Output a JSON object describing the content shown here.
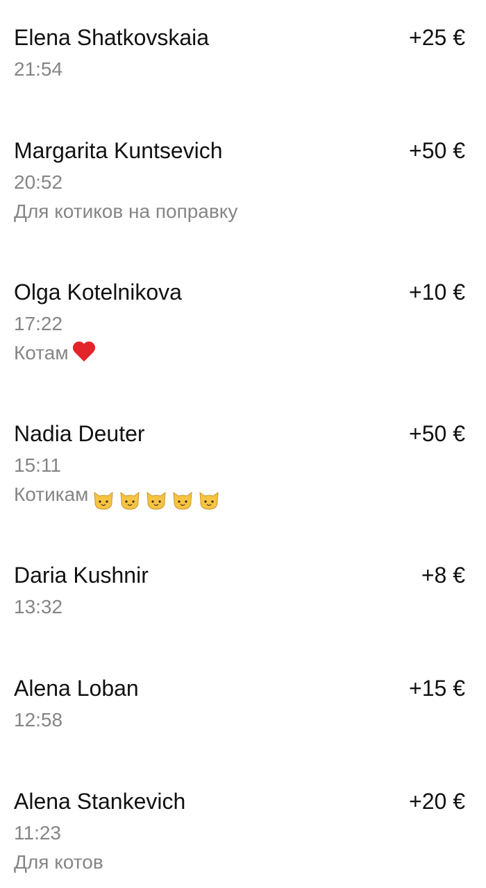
{
  "transactions": [
    {
      "name": "Elena Shatkovskaia",
      "amount": "+25 €",
      "time": "21:54",
      "comment": ""
    },
    {
      "name": "Margarita Kuntsevich",
      "amount": "+50 €",
      "time": "20:52",
      "comment": "Для котиков на поправку"
    },
    {
      "name": "Olga Kotelnikova",
      "amount": "+10 €",
      "time": "17:22",
      "comment": "Котам",
      "emoji": "red-heart"
    },
    {
      "name": "Nadia Deuter",
      "amount": "+50 €",
      "time": "15:11",
      "comment": "Котикам",
      "emoji": "cat-face",
      "emoji_count": 5
    },
    {
      "name": "Daria Kushnir",
      "amount": "+8 €",
      "time": "13:32",
      "comment": ""
    },
    {
      "name": "Alena Loban",
      "amount": "+15 €",
      "time": "12:58",
      "comment": ""
    },
    {
      "name": "Alena Stankevich",
      "amount": "+20 €",
      "time": "11:23",
      "comment": "Для котов"
    }
  ],
  "colors": {
    "primary_text": "#111111",
    "secondary_text": "#858585",
    "heart": "#e3242b",
    "cat": "#f6c343"
  }
}
